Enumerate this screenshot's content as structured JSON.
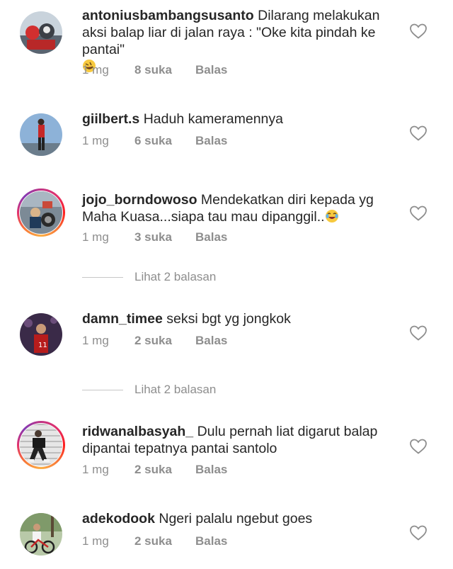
{
  "comments": [
    {
      "username": "antoniusbambangsusanto",
      "text": "Dilarang melakukan aksi balap liar di jalan raya : \"Oke kita pindah ke pantai\"",
      "emoji": "rofl-emoji",
      "time": "1 mg",
      "likes": "8 suka",
      "reply": "Balas",
      "story_ring": false
    },
    {
      "username": "giilbert.s",
      "text": "Haduh kameramennya",
      "time": "1 mg",
      "likes": "6 suka",
      "reply": "Balas",
      "story_ring": false
    },
    {
      "username": "jojo_borndowoso",
      "text": "Mendekatkan diri kepada yg Maha Kuasa...siapa tau mau dipanggil..",
      "emoji": "joy-emoji",
      "time": "1 mg",
      "likes": "3 suka",
      "reply": "Balas",
      "story_ring": true,
      "view_replies": "Lihat 2 balasan"
    },
    {
      "username": "damn_timee",
      "text": "seksi bgt yg jongkok",
      "time": "1 mg",
      "likes": "2 suka",
      "reply": "Balas",
      "story_ring": false,
      "view_replies": "Lihat 2 balasan"
    },
    {
      "username": "ridwanalbasyah_",
      "text": "Dulu pernah liat digarut balap dipantai tepatnya pantai santolo",
      "time": "1 mg",
      "likes": "2 suka",
      "reply": "Balas",
      "story_ring": true
    },
    {
      "username": "adekodook",
      "text": "Ngeri palalu ngebut goes",
      "time": "1 mg",
      "likes": "2 suka",
      "reply": "Balas",
      "story_ring": false
    }
  ],
  "icons": {
    "like": "heart-outline-icon"
  },
  "colors": {
    "text": "#262626",
    "meta": "#8e8e8e",
    "heart": "#8e8e8e"
  }
}
